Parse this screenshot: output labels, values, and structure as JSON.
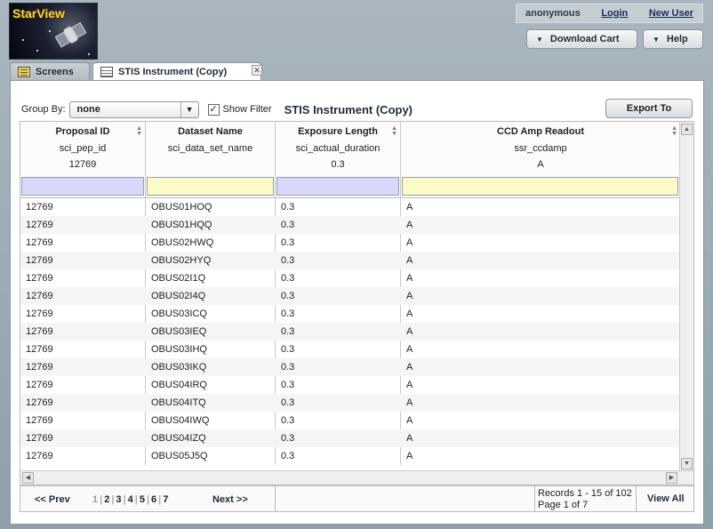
{
  "logo": {
    "text": "StarView"
  },
  "userbar": {
    "user": "anonymous",
    "login": "Login",
    "new_user": "New User"
  },
  "buttons": {
    "download_cart": "Download Cart",
    "help": "Help"
  },
  "tabs": [
    {
      "label": "Screens"
    },
    {
      "label": "STIS Instrument (Copy)"
    }
  ],
  "toolbar": {
    "group_by_label": "Group By:",
    "group_by_value": "none",
    "show_filter_checked": true,
    "show_filter_label": "Show Filter",
    "title": "STIS Instrument (Copy)",
    "export_label": "Export To"
  },
  "columns": [
    {
      "title": "Proposal ID",
      "field": "sci_pep_id",
      "example": "12769"
    },
    {
      "title": "Dataset Name",
      "field": "sci_data_set_name",
      "example": ""
    },
    {
      "title": "Exposure Length",
      "field": "sci_actual_duration",
      "example": "0.3"
    },
    {
      "title": "CCD Amp Readout",
      "field": "ssr_ccdamp",
      "example": "A"
    }
  ],
  "rows": [
    [
      "12769",
      "OBUS01HOQ",
      "0.3",
      "A"
    ],
    [
      "12769",
      "OBUS01HQQ",
      "0.3",
      "A"
    ],
    [
      "12769",
      "OBUS02HWQ",
      "0.3",
      "A"
    ],
    [
      "12769",
      "OBUS02HYQ",
      "0.3",
      "A"
    ],
    [
      "12769",
      "OBUS02I1Q",
      "0.3",
      "A"
    ],
    [
      "12769",
      "OBUS02I4Q",
      "0.3",
      "A"
    ],
    [
      "12769",
      "OBUS03ICQ",
      "0.3",
      "A"
    ],
    [
      "12769",
      "OBUS03IEQ",
      "0.3",
      "A"
    ],
    [
      "12769",
      "OBUS03IHQ",
      "0.3",
      "A"
    ],
    [
      "12769",
      "OBUS03IKQ",
      "0.3",
      "A"
    ],
    [
      "12769",
      "OBUS04IRQ",
      "0.3",
      "A"
    ],
    [
      "12769",
      "OBUS04ITQ",
      "0.3",
      "A"
    ],
    [
      "12769",
      "OBUS04IWQ",
      "0.3",
      "A"
    ],
    [
      "12769",
      "OBUS04IZQ",
      "0.3",
      "A"
    ],
    [
      "12769",
      "OBUS05J5Q",
      "0.3",
      "A"
    ]
  ],
  "pager": {
    "prev": "<< Prev",
    "pages": [
      "1",
      "2",
      "3",
      "4",
      "5",
      "6",
      "7"
    ],
    "current_page": "1",
    "next": "Next >>",
    "records_line1": "Records 1 - 15 of 102",
    "records_line2": "Page 1 of 7",
    "view_all": "View All"
  }
}
